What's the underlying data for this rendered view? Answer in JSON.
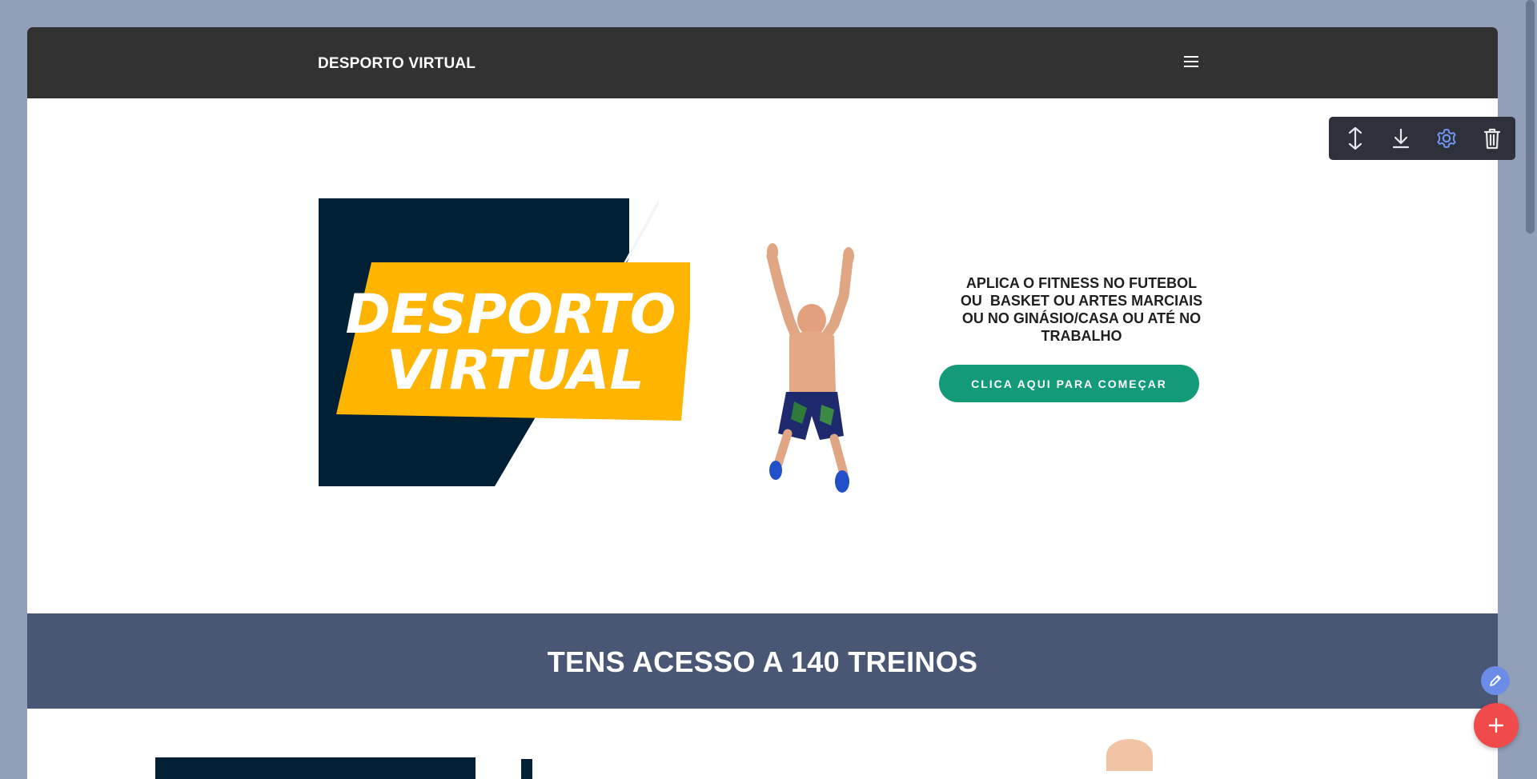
{
  "navbar": {
    "brand": "DESPORTO VIRTUAL",
    "menu_icon": "hamburger-menu-icon"
  },
  "hero": {
    "logo": {
      "text_line1": "DESPORTO",
      "text_line2": "VIRTUAL",
      "colors": {
        "dark": "#002035",
        "yellow": "#ffb400"
      }
    },
    "text_lines": [
      "APLICA O FITNESS NO FUTEBOL",
      "OU  BASKET OU ARTES MARCIAIS",
      "OU NO GINÁSIO/CASA OU ATÉ NO",
      "TRABALHO"
    ],
    "cta_label": "CLICA AQUI PARA COMEÇAR",
    "cta_color": "#139a79"
  },
  "band": {
    "title": "TENS ACESSO A 140 TREINOS",
    "background": "#495674"
  },
  "block_toolbar": {
    "tools": [
      {
        "icon": "move-vertical-icon"
      },
      {
        "icon": "download-icon"
      },
      {
        "icon": "gear-icon"
      },
      {
        "icon": "trash-icon"
      }
    ]
  },
  "fabs": {
    "edit_icon": "pencil-icon",
    "add_icon": "plus-icon"
  },
  "colors": {
    "page_background": "#919fb8",
    "navbar": "#333233",
    "toolbar": "#2f313a",
    "fab_add": "#f04a4a",
    "fab_edit": "#6b8de8"
  }
}
